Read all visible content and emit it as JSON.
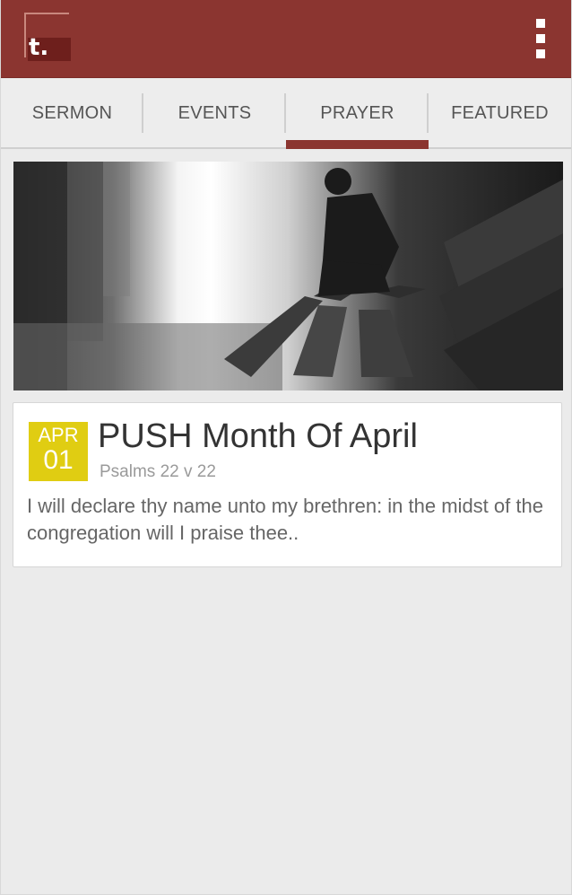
{
  "app": {
    "logo_glyph": "t.",
    "overflow_menu_icon": "more-vert-icon",
    "brand_color": "#8b3530"
  },
  "tabs": [
    {
      "label": "SERMON",
      "active": false
    },
    {
      "label": "EVENTS",
      "active": false
    },
    {
      "label": "PRAYER",
      "active": true
    },
    {
      "label": "FEATURED",
      "active": false
    }
  ],
  "hero": {
    "description": "Black and white photo"
  },
  "post": {
    "date_month": "APR",
    "date_day": "01",
    "badge_color": "#e0cd12",
    "title": "PUSH Month Of April",
    "reference": "Psalms 22 v 22",
    "excerpt": "I will declare thy name unto my brethren: in the midst of the congregation will I praise thee.."
  }
}
